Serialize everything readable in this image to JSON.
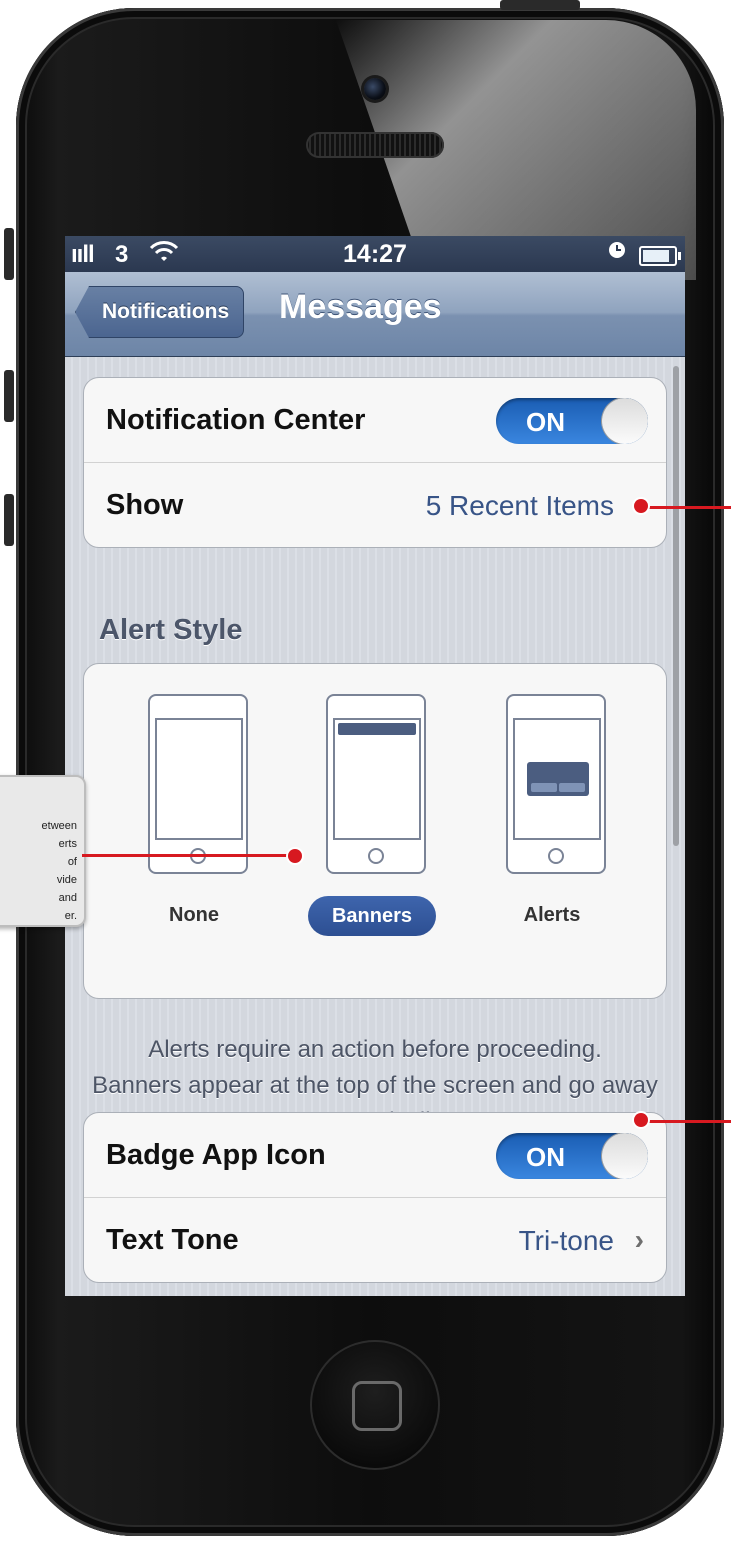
{
  "status_bar": {
    "signal": "ııll",
    "carrier": "3",
    "time": "14:27"
  },
  "nav": {
    "back_label": "Notifications",
    "title": "Messages"
  },
  "group1": {
    "notification_center_label": "Notification Center",
    "notification_center_state": "ON",
    "show_label": "Show",
    "show_value": "5 Recent Items"
  },
  "alert_style": {
    "header": "Alert Style",
    "options": [
      {
        "label": "None",
        "selected": false
      },
      {
        "label": "Banners",
        "selected": true
      },
      {
        "label": "Alerts",
        "selected": false
      }
    ]
  },
  "footer": {
    "line1": "Alerts require an action before proceeding.",
    "line2": "Banners appear at the top of the screen and go away automatically."
  },
  "group2": {
    "badge_label": "Badge App Icon",
    "badge_state": "ON",
    "tone_label": "Text Tone",
    "tone_value": "Tri-tone"
  },
  "annotation": {
    "text": "etween\nerts\nof\nvide\nand\ner."
  },
  "icons": {
    "wifi": "wifi-icon",
    "clock": "clock-icon",
    "battery": "battery-icon",
    "chevron": "chevron-right-icon"
  },
  "colors": {
    "callout": "#d71920",
    "toggle_on": "#2a72cc",
    "nav_bar": "#7b91b0"
  }
}
